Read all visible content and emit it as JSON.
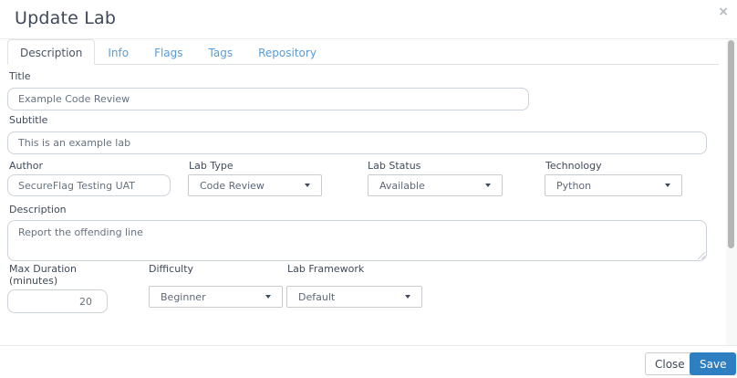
{
  "modal": {
    "title": "Update Lab",
    "close_icon": "×"
  },
  "tabs": [
    {
      "label": "Description",
      "active": true
    },
    {
      "label": "Info",
      "active": false
    },
    {
      "label": "Flags",
      "active": false
    },
    {
      "label": "Tags",
      "active": false
    },
    {
      "label": "Repository",
      "active": false
    }
  ],
  "form": {
    "title": {
      "label": "Title",
      "value": "Example Code Review"
    },
    "subtitle": {
      "label": "Subtitle",
      "value": "This is an example lab"
    },
    "author": {
      "label": "Author",
      "value": "SecureFlag Testing UAT"
    },
    "lab_type": {
      "label": "Lab Type",
      "value": "Code Review"
    },
    "lab_status": {
      "label": "Lab Status",
      "value": "Available"
    },
    "technology": {
      "label": "Technology",
      "value": "Python"
    },
    "description": {
      "label": "Description",
      "value": "Report the offending line"
    },
    "max_duration": {
      "label_line1": "Max Duration",
      "label_line2": "(minutes)",
      "value": "20"
    },
    "difficulty": {
      "label": "Difficulty",
      "value": "Beginner"
    },
    "lab_framework": {
      "label": "Lab Framework",
      "value": "Default"
    }
  },
  "footer": {
    "close_label": "Close",
    "save_label": "Save"
  },
  "colors": {
    "accent_blue": "#2d7fc1",
    "tab_link_blue": "#5a9cd8",
    "label_dark": "#3e4857"
  }
}
